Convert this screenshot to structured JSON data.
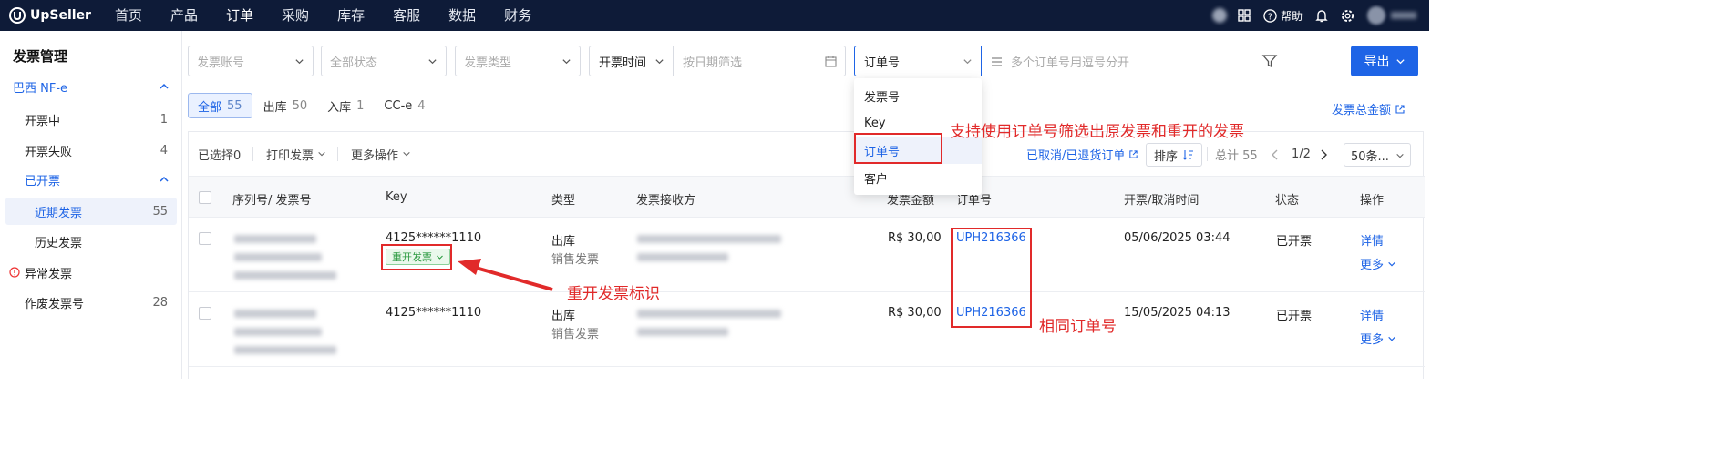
{
  "brand": {
    "name": "UpSeller"
  },
  "nav": [
    "首页",
    "产品",
    "订单",
    "采购",
    "库存",
    "客服",
    "数据",
    "财务"
  ],
  "top_right": {
    "help": "帮助"
  },
  "sidebar": {
    "title": "发票管理",
    "groups": [
      {
        "label": "巴西 NF-e"
      },
      {
        "label": "已开票"
      }
    ],
    "items": {
      "issuing": {
        "label": "开票中",
        "count": "1"
      },
      "failed": {
        "label": "开票失败",
        "count": "4"
      },
      "recent": {
        "label": "近期发票",
        "count": "55"
      },
      "history": {
        "label": "历史发票"
      },
      "abnormal": {
        "label": "异常发票"
      },
      "voided": {
        "label": "作废发票号",
        "count": "28"
      }
    }
  },
  "filters": {
    "account": "发票账号",
    "status": "全部状态",
    "type": "发票类型",
    "time_label": "开票时间",
    "date_placeholder": "按日期筛选",
    "order_field": "订单号",
    "order_placeholder": "多个订单号用逗号分开",
    "export": "导出"
  },
  "tabs": [
    {
      "label": "全部",
      "count": "55"
    },
    {
      "label": "出库",
      "count": "50"
    },
    {
      "label": "入库",
      "count": "1"
    },
    {
      "label": "CC-e",
      "count": "4"
    }
  ],
  "total_amount_link": "发票总金额",
  "toolbar": {
    "selected": "已选择0",
    "print": "打印发票",
    "more": "更多操作",
    "cancelled_link": "已取消/已退货订单",
    "sort": "排序",
    "total": "总计 55",
    "page": "1/2",
    "page_size": "50条..."
  },
  "columns": [
    "序列号/ 发票号",
    "Key",
    "类型",
    "发票接收方",
    "发票金额",
    "订单号",
    "开票/取消时间",
    "状态",
    "操作"
  ],
  "rows": [
    {
      "key": "4125******1110",
      "badge": "重开发票",
      "type": "出库",
      "type_sub": "销售发票",
      "amount": "R$ 30,00",
      "order": "UPH216366",
      "time": "05/06/2025 03:44",
      "status": "已开票",
      "detail": "详情",
      "more": "更多"
    },
    {
      "key": "4125******1110",
      "type": "出库",
      "type_sub": "销售发票",
      "amount": "R$ 30,00",
      "order": "UPH216366",
      "time": "15/05/2025 04:13",
      "status": "已开票",
      "detail": "详情",
      "more": "更多"
    }
  ],
  "dropdown": {
    "options": [
      "发票号",
      "Key",
      "订单号",
      "客户"
    ],
    "selected": "订单号"
  },
  "annotations": {
    "filter_note": "支持使用订单号筛选出原发票和重开的发票",
    "reissue_note": "重开发票标识",
    "same_order_note": "相同订单号"
  },
  "colors": {
    "primary": "#1e64e6",
    "topbar": "#0e1b38",
    "annotation_red": "#e12a2a",
    "badge_green": "#2c9a41"
  }
}
